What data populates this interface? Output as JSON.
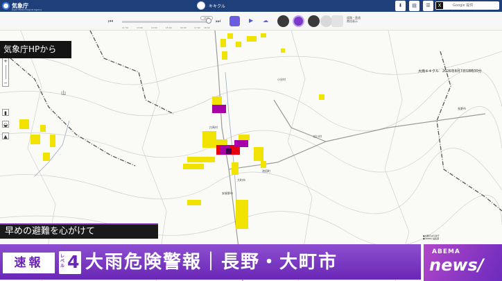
{
  "header": {
    "logo_text": "気象庁",
    "logo_sub": "Japan Meteorological Agency",
    "title": "キキクル",
    "search_placeholder": "Google 提供",
    "x_label": "X"
  },
  "toolbar": {
    "current_time": "18:30",
    "time_ticks": [
      "11:30",
      "13:00",
      "14:00",
      "15:00",
      "16:00",
      "17:00",
      "18:00"
    ],
    "legend_note": [
      "道路・鉄道",
      "費用表示"
    ]
  },
  "map": {
    "stamp": "大雨キキクル　2026年8月7日18時30分",
    "place_labels": [
      "白馬村",
      "大町市",
      "池田町",
      "安曇野市",
      "松川村",
      "小谷村",
      "長野市",
      "山"
    ],
    "credit": "気象庁HPから",
    "colors": {
      "yellow": "#f2e200",
      "red": "#e60012",
      "purple": "#a800a8",
      "darkpurple": "#3b0050"
    },
    "fineprint": [
      "●出典元は気象庁",
      "●ABEMA 編集部"
    ]
  },
  "caption": {
    "advice": "早めの避難を心がけて",
    "breaking": "速報",
    "level_word": "レベル",
    "level_num": "4",
    "headline": "大雨危険警報｜長野・大町市"
  },
  "brand": {
    "line1": "ABEMA",
    "line2": "news/"
  }
}
